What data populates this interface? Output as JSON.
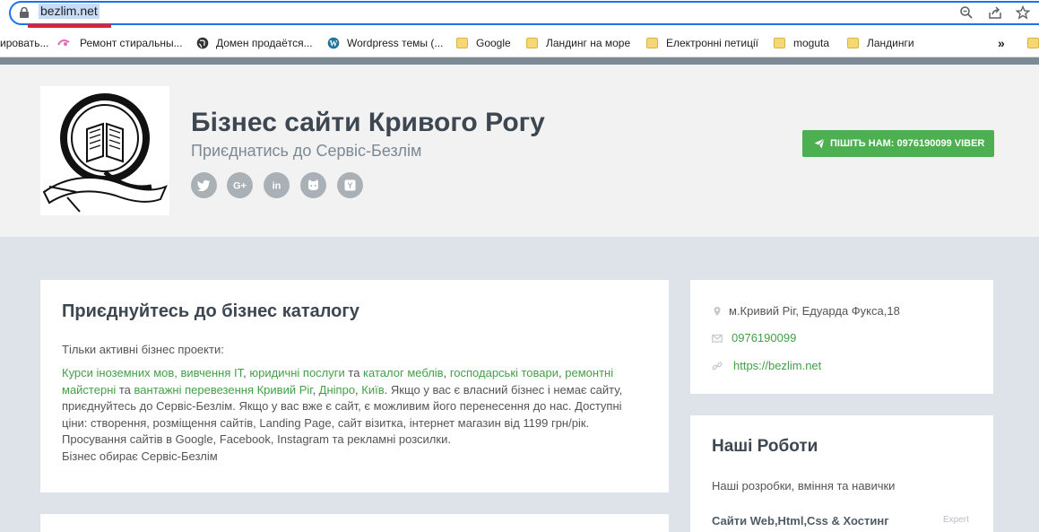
{
  "browser": {
    "url": "bezlim.net",
    "bookmarks": [
      {
        "label": "ировать..."
      },
      {
        "label": "Ремонт стиральны..."
      },
      {
        "label": "Домен продаётся..."
      },
      {
        "label": "Wordpress темы (..."
      },
      {
        "label": "Google"
      },
      {
        "label": "Ландинг на море"
      },
      {
        "label": "Електронні петиції"
      },
      {
        "label": "moguta"
      },
      {
        "label": "Ландинги"
      }
    ],
    "overflow_label": "»"
  },
  "header": {
    "title": "Бізнес сайти Кривого Рогу",
    "subtitle": "Приєднатись до Сервіс-Безлім",
    "social_icons": [
      "twitter-icon",
      "google-plus-icon",
      "linkedin-icon",
      "github-icon",
      "yandex-icon"
    ],
    "viber_button": "ПІШІТЬ НАМ: 0976190099 VIBER"
  },
  "main": {
    "title": "Приєднуйтесь до бізнес каталогу",
    "intro": "Тільки активні бізнес проекти:",
    "links": {
      "courses": "Курси іноземних мов, вивчення ІТ",
      "legal": "юридичні послуги",
      "furniture": "каталог меблів",
      "household": "господарські товари",
      "repair": "ремонтні майстерні",
      "cargo": "вантажні перевезення Кривий Ріг",
      "dnipro": "Дніпро",
      "kyiv": "Київ"
    },
    "text": {
      "sep1": ", ",
      "and1": " та ",
      "sep2": ", ",
      "sep3": ", ",
      "and2": " та ",
      "sep4": ", ",
      "rest": ". Якщо у вас є власний бізнес і немає сайту, приєднуйтесь до Сервіс-Безлім. Якщо у вас вже є сайт, є можливим його перенесення до нас. Доступні ціни: створення, розміщення сайтів, Landing Page, сайт візитка, інтернет магазин від 1199 грн/рік. Просування сайтів в Google, Facebook, Instagram та рекламні розсилки.",
      "closing": "Бізнес обирає Сервіс-Безлім"
    }
  },
  "contact": {
    "address": "м.Кривий Ріг, Едуарда Фукса,18",
    "phone": "0976190099",
    "website": "https://bezlim.net"
  },
  "works": {
    "title": "Наші Роботи",
    "description": "Наші розробки, вміння та навички",
    "skill": "Сайти Web,Html,Css & Хостинг",
    "skill_level": "Expert"
  },
  "colors": {
    "accent_green": "#4caf50",
    "link_green": "#43a047",
    "title": "#3d4751",
    "page_bg": "#dde3e9",
    "header_bg": "#f2f2f2"
  }
}
